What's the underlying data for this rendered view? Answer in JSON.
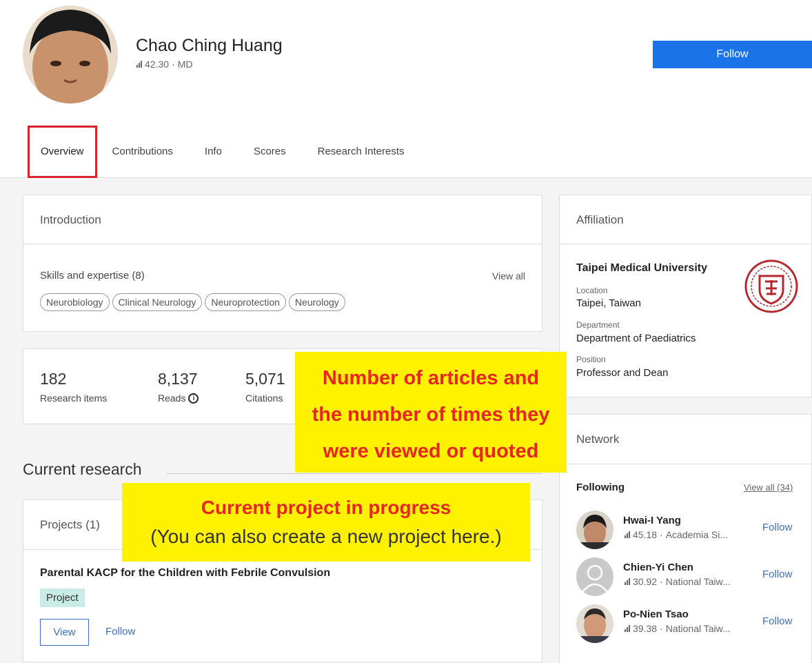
{
  "profile": {
    "name": "Chao Ching Huang",
    "score": "42.30",
    "degree": "MD",
    "follow_label": "Follow"
  },
  "tabs": [
    "Overview",
    "Contributions",
    "Info",
    "Scores",
    "Research Interests"
  ],
  "introduction": {
    "title": "Introduction",
    "skills_title": "Skills and expertise (8)",
    "view_all": "View all",
    "skills": [
      "Neurobiology",
      "Clinical Neurology",
      "Neuroprotection",
      "Neurology"
    ]
  },
  "stats": [
    {
      "value": "182",
      "label": "Research items"
    },
    {
      "value": "8,137",
      "label": "Reads"
    },
    {
      "value": "5,071",
      "label": "Citations"
    }
  ],
  "callouts": {
    "stats": [
      "Number of articles and",
      "the number of times they",
      "were viewed or quoted"
    ],
    "project_title": "Current project in progress",
    "project_sub": "(You can also create a new project here.)"
  },
  "current_research": {
    "heading": "Current research",
    "projects_title": "Projects (1)",
    "project_name": "Parental KACP for the Children with Febrile Convulsion",
    "badge": "Project",
    "view_label": "View",
    "follow_label": "Follow"
  },
  "affiliation": {
    "title": "Affiliation",
    "institution": "Taipei Medical University",
    "location_label": "Location",
    "location": "Taipei, Taiwan",
    "department_label": "Department",
    "department": "Department of Paediatrics",
    "position_label": "Position",
    "position": "Professor and Dean"
  },
  "network": {
    "title": "Network",
    "following_label": "Following",
    "view_all": "View all (34)",
    "people": [
      {
        "name": "Hwai-I Yang",
        "score": "45.18",
        "org": "Academia Si...",
        "follow": "Follow"
      },
      {
        "name": "Chien-Yi Chen",
        "score": "30.92",
        "org": "National Taiw...",
        "follow": "Follow"
      },
      {
        "name": "Po-Nien Tsao",
        "score": "39.38",
        "org": "National Taiw...",
        "follow": "Follow"
      }
    ]
  },
  "colors": {
    "accent": "#1a73e8",
    "highlight": "#fff200",
    "callout_text": "#e8261e",
    "tab_box": "#d9232d"
  }
}
